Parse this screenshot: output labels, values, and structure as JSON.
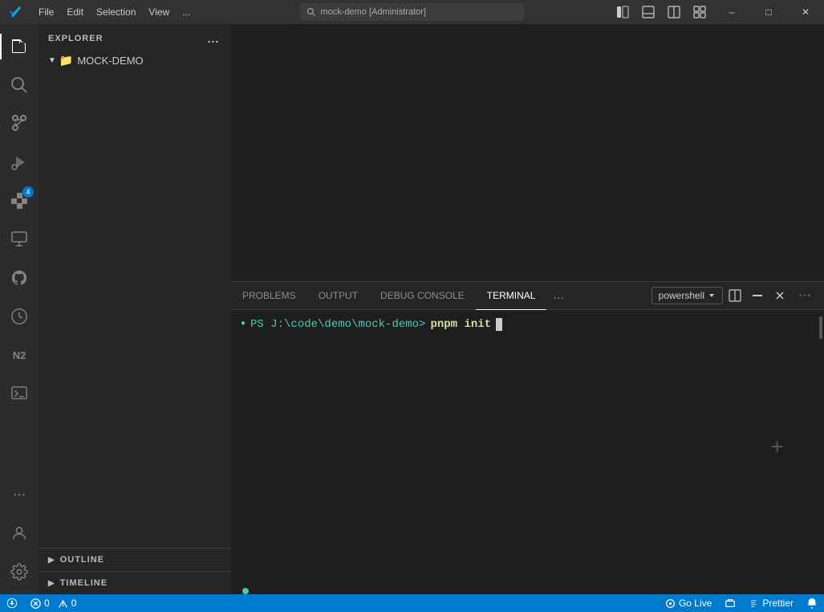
{
  "titlebar": {
    "menu": [
      "File",
      "Edit",
      "Selection",
      "View",
      "..."
    ],
    "search_placeholder": "mock-demo [Administrator]",
    "search_icon": "search",
    "layout_btns": [
      "sidebar-icon",
      "panel-icon",
      "split-icon",
      "grid-icon"
    ],
    "controls": [
      "minimize",
      "maximize",
      "close"
    ]
  },
  "activity_bar": {
    "items": [
      {
        "name": "explorer",
        "icon": "files",
        "active": true
      },
      {
        "name": "search",
        "icon": "search"
      },
      {
        "name": "source-control",
        "icon": "git"
      },
      {
        "name": "run-debug",
        "icon": "run"
      },
      {
        "name": "extensions",
        "icon": "extensions",
        "badge": "4"
      },
      {
        "name": "remote-explorer",
        "icon": "remote"
      },
      {
        "name": "github",
        "icon": "github"
      },
      {
        "name": "timeline",
        "icon": "timeline"
      },
      {
        "name": "n2",
        "icon": "n2"
      },
      {
        "name": "terminal-nav",
        "icon": "terminal"
      }
    ],
    "bottom": [
      {
        "name": "more",
        "icon": "more"
      },
      {
        "name": "account",
        "icon": "account"
      },
      {
        "name": "settings",
        "icon": "settings"
      }
    ]
  },
  "sidebar": {
    "title": "EXPLORER",
    "more_btn": "...",
    "folder": {
      "name": "MOCK-DEMO",
      "expanded": true
    },
    "panels": [
      {
        "id": "outline",
        "label": "OUTLINE",
        "expanded": false
      },
      {
        "id": "timeline",
        "label": "TIMELINE",
        "expanded": false
      }
    ]
  },
  "terminal": {
    "tabs": [
      {
        "id": "problems",
        "label": "PROBLEMS"
      },
      {
        "id": "output",
        "label": "OUTPUT"
      },
      {
        "id": "debug-console",
        "label": "DEBUG CONSOLE"
      },
      {
        "id": "terminal",
        "label": "TERMINAL",
        "active": true
      }
    ],
    "more_btn": "...",
    "shell_label": "powershell",
    "right_btns": [
      "split",
      "kill",
      "more"
    ],
    "prompt": "PS J:\\code\\demo\\mock-demo>",
    "command": "pnpm init",
    "cursor_visible": true,
    "indicator_dot_color": "#4ec9b0"
  },
  "statusbar": {
    "left": [
      {
        "id": "remote",
        "icon": "remote",
        "text": ""
      },
      {
        "id": "errors",
        "icon": "error",
        "text": "0",
        "warning_text": "0"
      },
      {
        "id": "warnings",
        "icon": "warning",
        "text": "0"
      }
    ],
    "right": [
      {
        "id": "go-live",
        "icon": "live",
        "text": "Go Live"
      },
      {
        "id": "port",
        "icon": "port",
        "text": ""
      },
      {
        "id": "prettier",
        "icon": "prettier",
        "text": "Prettier"
      },
      {
        "id": "notifications",
        "icon": "bell",
        "text": ""
      }
    ],
    "bg_color": "#007acc"
  }
}
